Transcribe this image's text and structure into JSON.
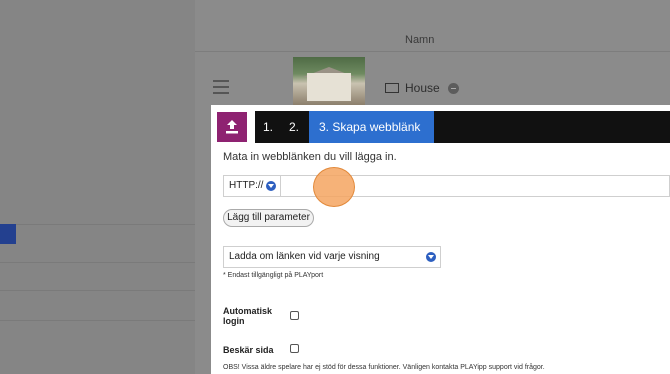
{
  "background": {
    "column_header": "Namn",
    "row_label": "House"
  },
  "modal": {
    "steps": [
      "1.",
      "2.",
      "3. Skapa webblänk"
    ],
    "instruction": "Mata in webblänken du vill lägga in.",
    "protocol_value": "HTTP://",
    "url_value": "",
    "add_param_label": "Lägg till parameter",
    "reload_option": "Ladda om länken vid varje visning",
    "note": "* Endast tillgängligt på PLAYport",
    "auto_login_label": "Automatisk login",
    "auto_login_checked": false,
    "crop_label": "Beskär sida",
    "crop_checked": false,
    "obs_text": "OBS! Vissa äldre spelare har ej stöd för dessa funktioner. Vänligen kontakta PLAYipp support vid frågor."
  },
  "colors": {
    "accent_blue": "#2d6fcf",
    "upload_magenta": "#8e2271",
    "step_bar": "#111111",
    "click_marker": "#f4a460"
  }
}
